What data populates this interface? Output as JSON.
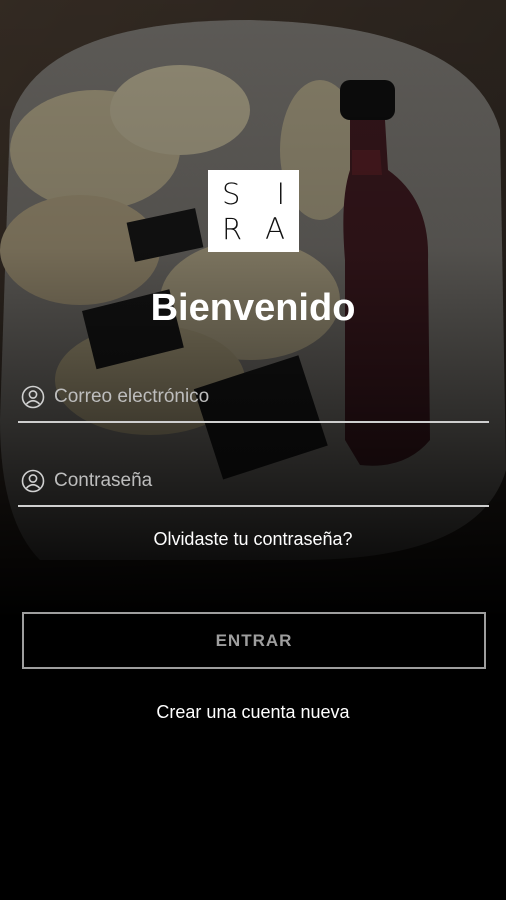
{
  "logo": {
    "row1": [
      "S",
      "I"
    ],
    "row2": [
      "R",
      "A"
    ]
  },
  "welcome_title": "Bienvenido",
  "email_field": {
    "placeholder": "Correo electrónico",
    "value": "",
    "icon": "user-icon"
  },
  "password_field": {
    "placeholder": "Contraseña",
    "value": "",
    "icon": "user-icon"
  },
  "forgot_password_link": "Olvidaste tu contraseña?",
  "enter_button": "ENTRAR",
  "create_account_link": "Crear una cuenta nueva",
  "colors": {
    "background": "#000000",
    "text": "#ffffff",
    "placeholder": "#bdbdbd",
    "button_border": "#9e9e9e",
    "field_underline": "#cfcfcf"
  }
}
